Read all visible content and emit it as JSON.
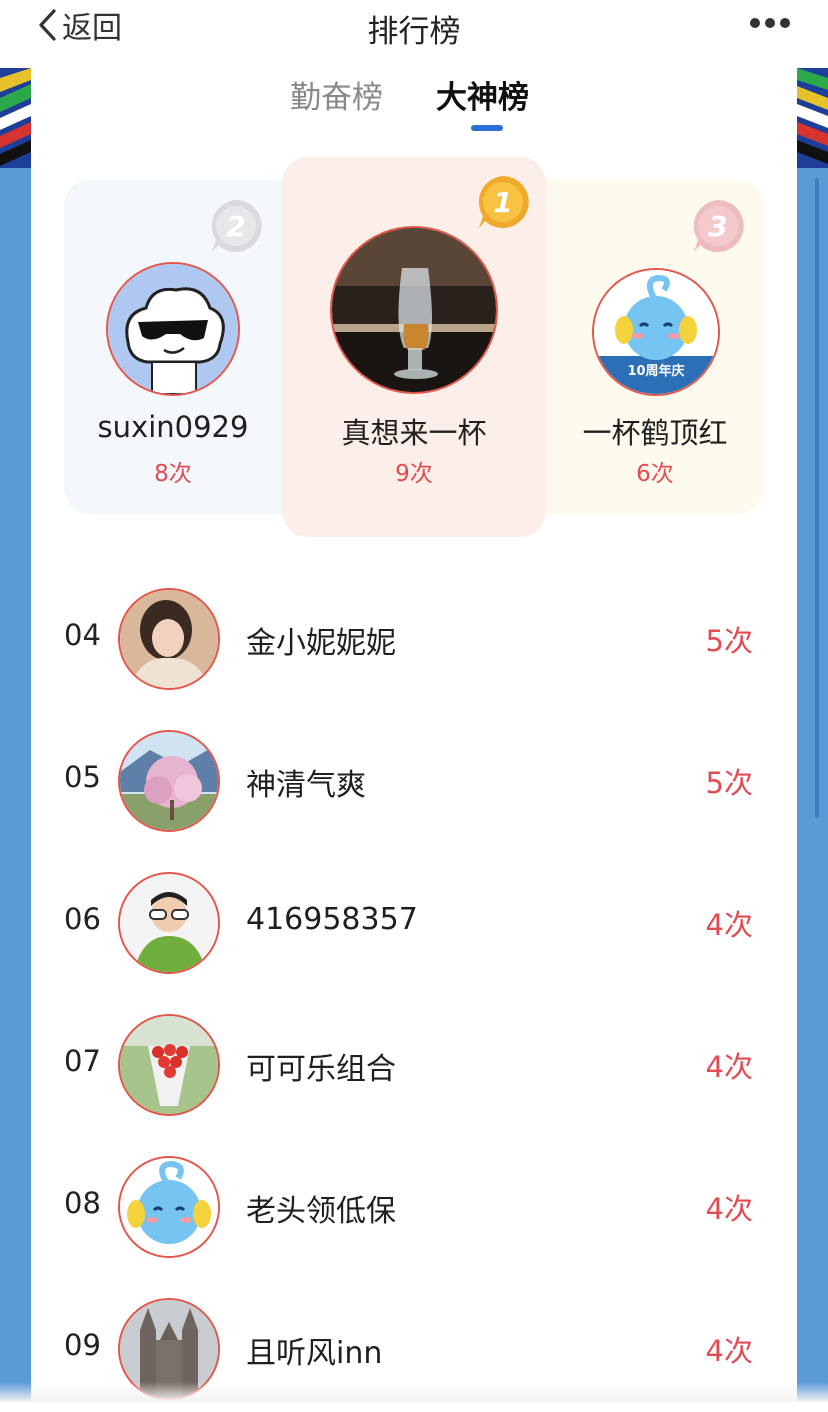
{
  "nav": {
    "back_label": "返回",
    "title": "排行榜"
  },
  "tabs": [
    {
      "label": "勤奋榜",
      "active": false
    },
    {
      "label": "大神榜",
      "active": true
    }
  ],
  "podium": {
    "first": {
      "rank": "1",
      "name": "真想来一杯",
      "count": "9次"
    },
    "second": {
      "rank": "2",
      "name": "suxin0929",
      "count": "8次"
    },
    "third": {
      "rank": "3",
      "name": "一杯鹤顶红",
      "count": "6次",
      "badge_text": "10周年庆"
    }
  },
  "list": [
    {
      "rank": "04",
      "name": "金小妮妮妮",
      "count": "5次"
    },
    {
      "rank": "05",
      "name": "神清气爽",
      "count": "5次"
    },
    {
      "rank": "06",
      "name": "416958357",
      "count": "4次"
    },
    {
      "rank": "07",
      "name": "可可乐组合",
      "count": "4次"
    },
    {
      "rank": "08",
      "name": "老头领低保",
      "count": "4次"
    },
    {
      "rank": "09",
      "name": "且听风inn",
      "count": "4次"
    }
  ],
  "colors": {
    "accent_red": "#e14b52",
    "tab_indicator": "#2e6fd6",
    "side_blue": "#5a9ad6",
    "gold": "#f2b632"
  },
  "icons": [
    "back-chevron-icon",
    "more-dots-icon",
    "gold-medal-icon",
    "silver-medal-icon",
    "bronze-medal-icon"
  ]
}
